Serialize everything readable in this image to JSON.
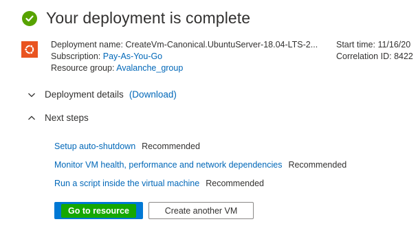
{
  "header": {
    "title": "Your deployment is complete",
    "status_icon": "check-circle-icon",
    "status_color": "#57a300"
  },
  "deployment": {
    "icon": "ubuntu-icon",
    "icon_color": "#e95420",
    "name_label": "Deployment name:",
    "name_value": "CreateVm-Canonical.UbuntuServer-18.04-LTS-2...",
    "subscription_label": "Subscription:",
    "subscription_value": "Pay-As-You-Go",
    "resource_group_label": "Resource group:",
    "resource_group_value": "Avalanche_group",
    "start_time_label": "Start time:",
    "start_time_value": "11/16/20",
    "correlation_label": "Correlation ID:",
    "correlation_value": "8422"
  },
  "sections": {
    "details": {
      "title": "Deployment details",
      "download": "(Download)",
      "icon": "chevron-down-icon"
    },
    "next_steps": {
      "title": "Next steps",
      "icon": "chevron-up-icon"
    }
  },
  "next_steps": [
    {
      "link": "Setup auto-shutdown",
      "tag": "Recommended"
    },
    {
      "link": "Monitor VM health, performance and network dependencies",
      "tag": "Recommended"
    },
    {
      "link": "Run a script inside the virtual machine",
      "tag": "Recommended"
    }
  ],
  "buttons": {
    "primary": "Go to resource",
    "secondary": "Create another VM"
  },
  "colors": {
    "link": "#0067b8",
    "primary_button": "#0078d4",
    "highlight": "#15a800"
  }
}
